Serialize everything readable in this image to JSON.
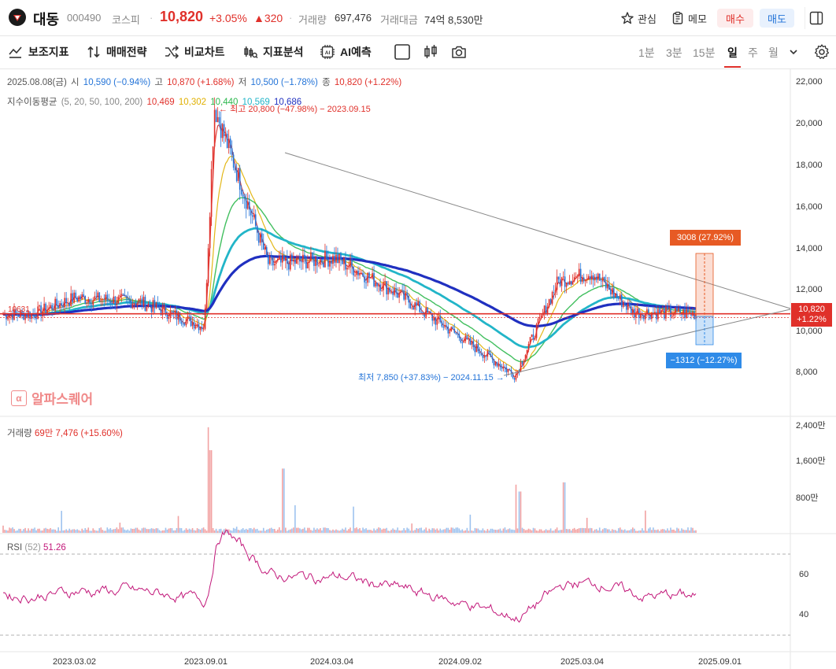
{
  "header": {
    "name": "대동",
    "code": "000490",
    "market": "코스피",
    "price": "10,820",
    "change_rate": "+3.05%",
    "change": "▲320",
    "volume_label": "거래량",
    "volume_value": "697,476",
    "amount_label": "거래대금",
    "amount_value": "74억 8,530만",
    "watch_label": "관심",
    "memo_label": "메모",
    "buy_label": "매수",
    "sell_label": "매도"
  },
  "toolbar": {
    "items": [
      "보조지표",
      "매매전략",
      "비교차트",
      "지표분석",
      "AI예측"
    ],
    "periods": [
      "1분",
      "3분",
      "15분",
      "일",
      "주",
      "월"
    ],
    "active_period": "일"
  },
  "legend": {
    "date": "2025.08.08(금)",
    "open_label": "시",
    "open": "10,590 (−0.94%)",
    "high_label": "고",
    "high": "10,870 (+1.68%)",
    "low_label": "저",
    "low": "10,500 (−1.78%)",
    "close_label": "종",
    "close": "10,820 (+1.22%)",
    "ma_label": "지수이동평균",
    "ma_periods": "(5, 20, 50, 100, 200)",
    "ma_values": [
      "10,469",
      "10,302",
      "10,440",
      "10,569",
      "10,686"
    ],
    "ma_colors": [
      "#e0302a",
      "#e0b000",
      "#2db84e",
      "#22b5c8",
      "#2030c0"
    ]
  },
  "annotations": {
    "high": "최고 20,800 (−47.98%) − 2023.09.15",
    "low": "최저 7,850 (+37.83%) − 2024.11.15",
    "up_tag": "3008 (27.92%)",
    "down_tag": "−1312 (−12.27%)",
    "left_price": "10631",
    "price_tag_value": "10,820",
    "price_tag_rate": "+1.22%"
  },
  "watermark": {
    "icon": "α",
    "text": "알파스퀘어"
  },
  "price_axis": [
    "22,000",
    "20,000",
    "18,000",
    "16,000",
    "14,000",
    "12,000",
    "10,000",
    "8,000"
  ],
  "volume_axis": [
    "2,400만",
    "1,600만",
    "800만"
  ],
  "rsi_axis": [
    "60",
    "40"
  ],
  "date_axis": [
    "2023.03.02",
    "2023.09.01",
    "2024.03.04",
    "2024.09.02",
    "2025.03.04",
    "2025.09.01"
  ],
  "volume_legend": {
    "label": "거래량",
    "value": "69만 7,476 (+15.60%)"
  },
  "rsi_legend": {
    "label": "RSI",
    "param": "(52)",
    "value": "51.26"
  },
  "chart_data": {
    "type": "line",
    "title": "",
    "x_dates": [
      "2023-01-01",
      "2023-03-02",
      "2023-06-01",
      "2023-09-01",
      "2023-09-15",
      "2023-12-01",
      "2024-03-04",
      "2024-06-01",
      "2024-09-02",
      "2024-11-15",
      "2025-01-15",
      "2025-03-04",
      "2025-05-01",
      "2025-08-08"
    ],
    "series": [
      {
        "values": [
          10800,
          11600,
          11400,
          10200,
          20800,
          13200,
          13500,
          11800,
          9600,
          7850,
          12400,
          12800,
          10900,
          10820
        ]
      }
    ],
    "ylim": [
      7000,
      22500
    ],
    "rsi": {
      "value": 51.26,
      "period": 52,
      "levels": [
        70,
        30
      ]
    },
    "volume_ylim": [
      0,
      2400
    ]
  }
}
